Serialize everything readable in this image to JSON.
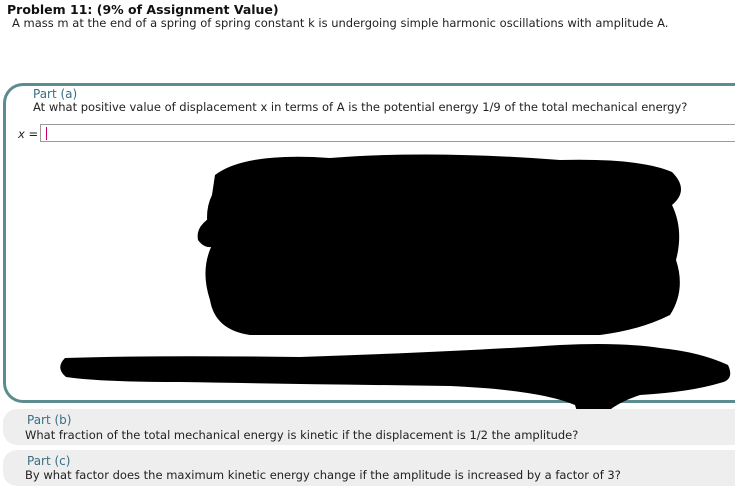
{
  "problem": {
    "title": "Problem 11: (9% of Assignment Value)",
    "description": "A mass m at the end of a spring of spring constant k is undergoing simple harmonic oscillations with amplitude A."
  },
  "part_a": {
    "label": "Part (a)",
    "question": "At what positive value of displacement x in terms of A is the potential energy 1/9 of the total mechanical energy?",
    "answer_label": "x =",
    "answer_value": ""
  },
  "part_b": {
    "label": "Part (b)",
    "question": "What fraction of the total mechanical energy is kinetic if the displacement is 1/2 the amplitude?"
  },
  "part_c": {
    "label": "Part (c)",
    "question": "By what factor does the maximum kinetic energy change if the amplitude is increased by a factor of 3?"
  },
  "colors": {
    "panel_border": "#5b8d8f",
    "part_label": "#3b6e86",
    "redaction": "#000000"
  }
}
